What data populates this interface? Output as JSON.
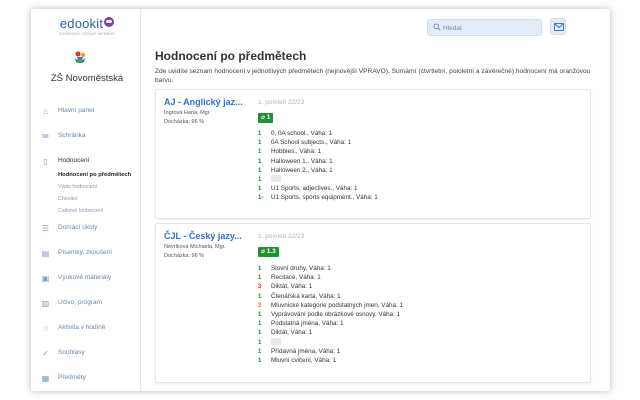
{
  "app": {
    "brand": "edookit",
    "tagline": "KOMENSKÝ GROUP MEMBER",
    "school_name": "ZŠ Novoměstská"
  },
  "header": {
    "search_placeholder": "Hledat"
  },
  "sidebar": {
    "items": [
      {
        "label": "Hlavní panel",
        "icon": "home-icon"
      },
      {
        "label": "Schránka",
        "icon": "inbox-icon"
      },
      {
        "label": "Hodnocení",
        "icon": "book-icon"
      },
      {
        "label": "Domácí úkoly",
        "icon": "homework-icon"
      },
      {
        "label": "Písemky, zkoušení",
        "icon": "exam-icon"
      },
      {
        "label": "Výukové materiály",
        "icon": "materials-icon"
      },
      {
        "label": "Učivo, program",
        "icon": "program-icon"
      },
      {
        "label": "Aktivita v hodině",
        "icon": "activity-icon"
      },
      {
        "label": "Souhlasy",
        "icon": "consent-icon"
      },
      {
        "label": "Předměty",
        "icon": "subjects-icon"
      }
    ],
    "submenu": [
      "Hodnocení po předmětech",
      "Výpis hodnocení",
      "Chování",
      "Celkové hodnocení"
    ]
  },
  "main": {
    "title": "Hodnocení po předmětech",
    "intro": "Zde uvidíte seznam hodnocení v jednotlivých předmětech (nejnovější VPRAVO). Sumární (čtvrtletní, pololetní a závěrečné) hodnocení má oranžovou barvu."
  },
  "subjects": [
    {
      "name": "AJ - Anglický jaz...",
      "teacher": "Ingrová Hana, Mgr.",
      "attendance": "Docházka: 96 %",
      "period": "1. pololetí 22/23",
      "average": "⌀ 1",
      "grades": [
        {
          "grade": "1",
          "text": "0, 0A school., Váha: 1"
        },
        {
          "grade": "1",
          "text": "0A School subjects., Váha: 1"
        },
        {
          "grade": "1",
          "text": "Hobbies., Váha: 1"
        },
        {
          "grade": "1",
          "text": "Halloween 1., Váha: 1"
        },
        {
          "grade": "1",
          "text": "Halloween 2., Váha: 1"
        },
        {
          "grade": "1",
          "text": ""
        },
        {
          "grade": "1",
          "text": "U1 Sports, adjectives., Váha: 1"
        },
        {
          "grade": "1-",
          "text": "U1 Sports, sports equipment., Váha: 1"
        }
      ]
    },
    {
      "name": "ČJL - Český jazy...",
      "teacher": "Nevrlková Michaela, Mgr.",
      "attendance": "Docházka: 96 %",
      "period": "1. pololetí 22/23",
      "average": "⌀ 1.3",
      "grades": [
        {
          "grade": "1",
          "text": "Slovní druhy, Váha: 1"
        },
        {
          "grade": "1",
          "text": "Recitace, Váha: 1"
        },
        {
          "grade": "3",
          "text": "Diktát, Váha: 1"
        },
        {
          "grade": "1",
          "text": "Čtenářská karta, Váha: 1"
        },
        {
          "grade": "2",
          "text": "Mluvnické kategorie podstatných jmen, Váha: 1"
        },
        {
          "grade": "1",
          "text": "Vyprávování podle obrázkové osnovy, Váha: 1"
        },
        {
          "grade": "1",
          "text": "Podstatná jména, Váha: 1"
        },
        {
          "grade": "1",
          "text": "Diktát, Váha: 1"
        },
        {
          "grade": "1",
          "text": ""
        },
        {
          "grade": "1",
          "text": "Přídavná jména, Váha: 1"
        },
        {
          "grade": "1",
          "text": "Mluvní cvičení, Váha: 1"
        }
      ]
    }
  ],
  "colors": {
    "accent": "#2f6fd0",
    "average_badge": "#1e9132",
    "grade_1": "#1c7a2c",
    "grade_2": "#e07a1a",
    "grade_3": "#d02b2b"
  }
}
